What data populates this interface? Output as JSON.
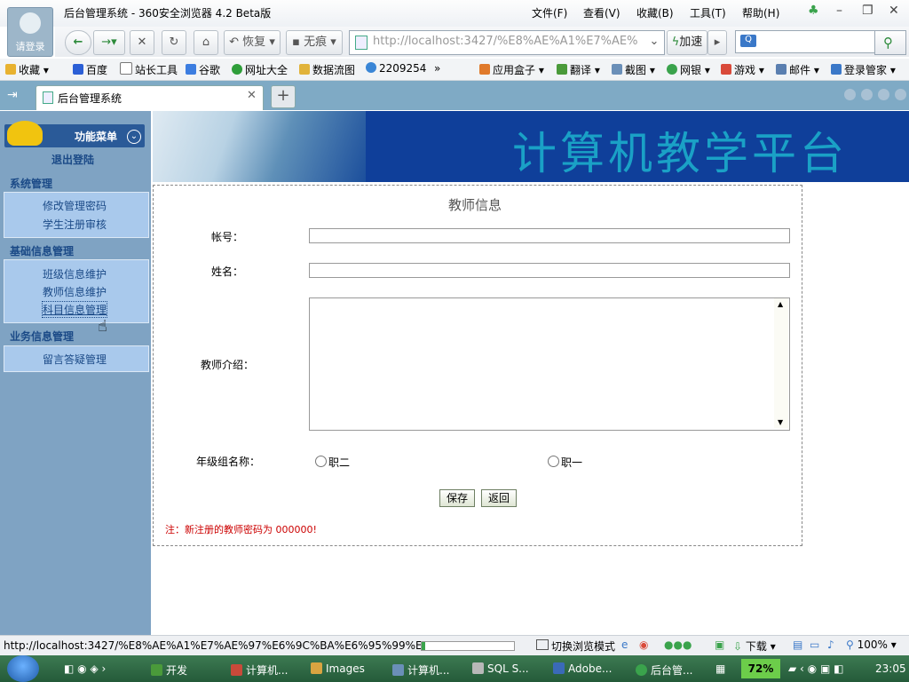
{
  "window": {
    "title": "后台管理系统 - 360安全浏览器 4.2 Beta版",
    "login_label": "请登录",
    "menu": [
      "文件(F)",
      "查看(V)",
      "收藏(B)",
      "工具(T)",
      "帮助(H)"
    ]
  },
  "toolbar": {
    "restore_label": "恢复",
    "notrace_label": "无痕",
    "url": "http://localhost:3427/%E8%AE%A1%E7%AE%",
    "accelerate_label": "加速"
  },
  "bookmarks": {
    "items": [
      "收藏",
      "百度",
      "站长工具",
      "谷歌",
      "网址大全",
      "数据流图",
      "2209254"
    ],
    "overflow": "»",
    "right_items": [
      "应用盒子",
      "翻译",
      "截图",
      "网银",
      "游戏",
      "邮件",
      "登录管家"
    ]
  },
  "tabs": [
    {
      "label": "后台管理系统"
    }
  ],
  "sidebar": {
    "header_label": "功能菜单",
    "logout_label": "退出登陆",
    "sections": [
      {
        "title": "系统管理",
        "items": [
          "修改管理密码",
          "学生注册审核"
        ]
      },
      {
        "title": "基础信息管理",
        "items": [
          "班级信息维护",
          "教师信息维护",
          "科目信息管理"
        ]
      },
      {
        "title": "业务信息管理",
        "items": [
          "留言答疑管理"
        ]
      }
    ]
  },
  "banner": {
    "title": "计算机教学平台"
  },
  "form": {
    "title": "教师信息",
    "account_label": "帐号：",
    "account_value": "",
    "name_label": "姓名：",
    "name_value": "",
    "intro_label": "教师介绍：",
    "intro_value": "",
    "grade_label": "年级组名称：",
    "grade_options": [
      "职二",
      "职一"
    ],
    "save_label": "保存",
    "back_label": "返回",
    "note": "注：新注册的教师密码为 000000!"
  },
  "statusbar": {
    "url": "http://localhost:3427/%E8%AE%A1%E7%AE%97%E6%9C%BA%E6%95%99%E5",
    "progress": 0.04,
    "switch_mode_label": "切换浏览模式",
    "download_label": "下载",
    "zoom": "100%"
  },
  "taskbar": {
    "items": [
      "开发",
      "计算机...",
      "Images",
      "计算机...",
      "SQL S...",
      "Adobe...",
      "后台管..."
    ],
    "battery": "72%",
    "time": "23:05"
  },
  "colors": {
    "sidebar_bg": "#7fa3c3",
    "tabbar_bg": "#7faac5",
    "banner_bg": "#0f3f9a",
    "note_red": "#cc0000",
    "taskbar_green": "#2f6b45"
  }
}
